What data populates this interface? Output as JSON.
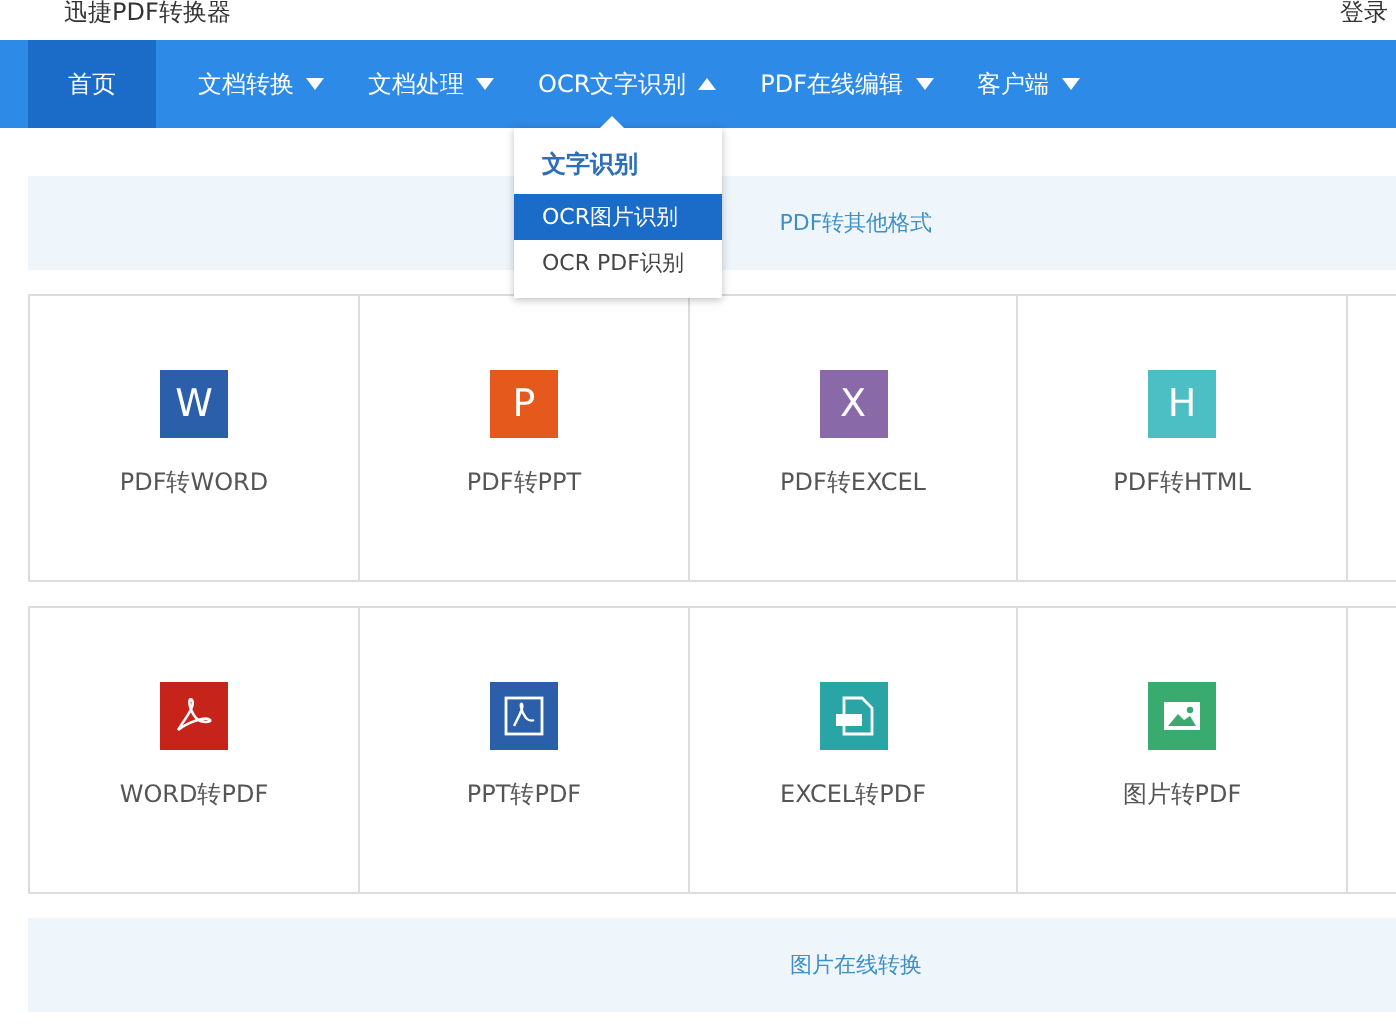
{
  "header": {
    "app_title": "迅捷PDF转换器",
    "login": "登录"
  },
  "nav": [
    {
      "label": "首页",
      "selected": true
    },
    {
      "label": "文档转换",
      "selected": false,
      "expanded": false
    },
    {
      "label": "文档处理",
      "selected": false,
      "expanded": false
    },
    {
      "label": "OCR文字识别",
      "selected": false,
      "expanded": true
    },
    {
      "label": "PDF在线编辑",
      "selected": false,
      "expanded": false
    },
    {
      "label": "客户端",
      "selected": false,
      "expanded": false
    }
  ],
  "dropdown": {
    "heading": "文字识别",
    "items": [
      {
        "label": "OCR图片识别",
        "selected": true
      },
      {
        "label": "OCR PDF识别",
        "selected": false
      }
    ]
  },
  "sections": [
    {
      "title": "PDF转其他格式",
      "tools": [
        {
          "label": "PDF转WORD",
          "kind": "letter",
          "glyph": "W",
          "color": "#2b5fa9"
        },
        {
          "label": "PDF转PPT",
          "kind": "letter",
          "glyph": "P",
          "color": "#e5591d"
        },
        {
          "label": "PDF转EXCEL",
          "kind": "letter",
          "glyph": "X",
          "color": "#8a69a9"
        },
        {
          "label": "PDF转HTML",
          "kind": "letter",
          "glyph": "H",
          "color": "#4cbfc5"
        }
      ]
    },
    {
      "tools": [
        {
          "label": "WORD转PDF",
          "kind": "acrobat",
          "color": "#c6241b"
        },
        {
          "label": "PPT转PDF",
          "kind": "pdf-file",
          "color": "#2b5fa9"
        },
        {
          "label": "EXCEL转PDF",
          "kind": "pdf-doc",
          "color": "#29a5a5"
        },
        {
          "label": "图片转PDF",
          "kind": "image",
          "color": "#3aab6f"
        }
      ]
    },
    {
      "title": "图片在线转换"
    }
  ]
}
